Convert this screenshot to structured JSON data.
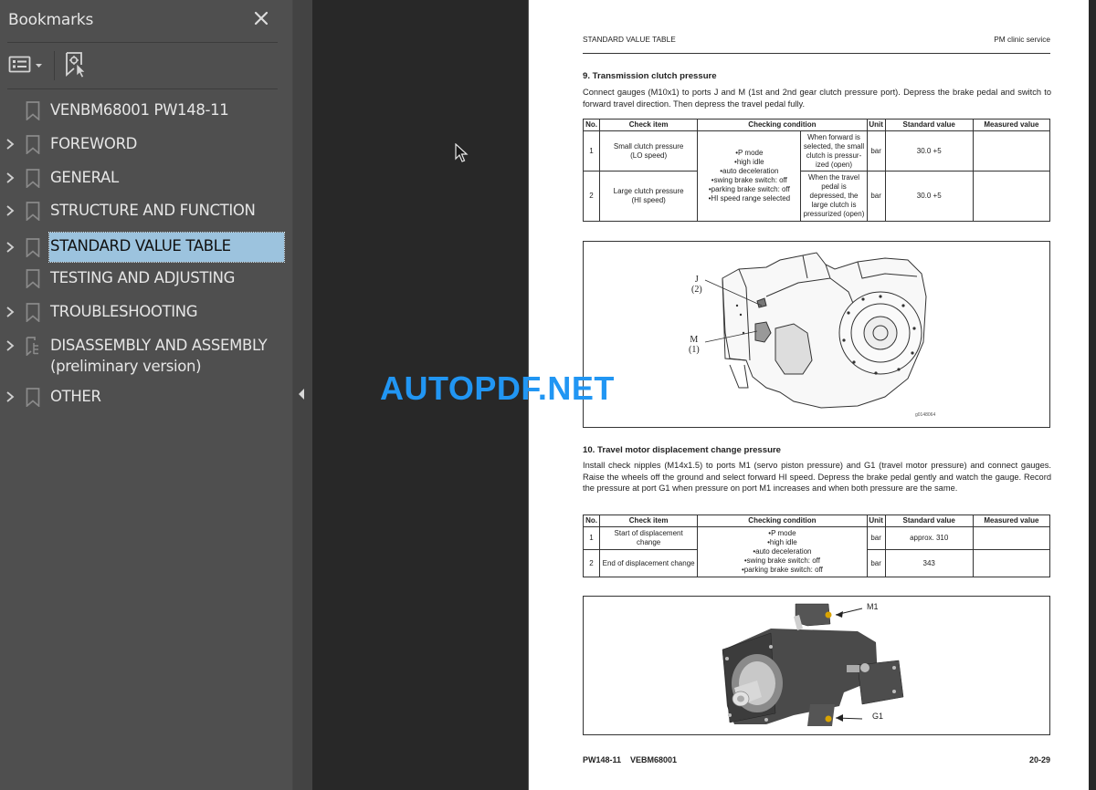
{
  "sidebar": {
    "title": "Bookmarks",
    "close_icon": "close-icon",
    "toolbar": {
      "options_icon": "list-options-icon",
      "options_dropdown_icon": "caret-down-icon",
      "find_bookmark_icon": "find-current-bookmark-icon"
    },
    "items": [
      {
        "label": "VENBM68001 PW148-11",
        "expandable": false,
        "icon": "bookmark-icon",
        "selected": false
      },
      {
        "label": "FOREWORD",
        "expandable": true,
        "icon": "bookmark-icon",
        "selected": false
      },
      {
        "label": "GENERAL",
        "expandable": true,
        "icon": "bookmark-icon",
        "selected": false
      },
      {
        "label": "STRUCTURE AND FUNCTION",
        "expandable": true,
        "icon": "bookmark-icon",
        "selected": false
      },
      {
        "label": "STANDARD VALUE TABLE",
        "expandable": true,
        "icon": "bookmark-icon",
        "selected": true
      },
      {
        "label": "TESTING AND ADJUSTING",
        "expandable": false,
        "icon": "bookmark-icon",
        "selected": false
      },
      {
        "label": "TROUBLESHOOTING",
        "expandable": true,
        "icon": "bookmark-icon",
        "selected": false
      },
      {
        "label": "DISASSEMBLY AND ASSEMBLY",
        "label_line2": "(preliminary version)",
        "expandable": true,
        "icon": "tagged-bookmark-icon",
        "selected": false
      },
      {
        "label": "OTHER",
        "expandable": true,
        "icon": "bookmark-icon",
        "selected": false
      }
    ],
    "collapse_icon": "collapse-panel-icon"
  },
  "colors": {
    "sidebar_bg": "#4f4f4f",
    "doc_bg": "#282828",
    "selected_bg": "#9cc3de",
    "watermark": "#2196f3"
  },
  "page": {
    "header_left": "STANDARD VALUE TABLE",
    "header_right": "PM clinic service",
    "section9": {
      "title": "9.   Transmission clutch pressure",
      "body": "Connect gauges (M10x1) to ports J and M (1st and 2nd gear clutch pressure port). Depress the brake pedal and switch to forward travel direction. Then depress the travel pedal fully.",
      "table": {
        "headers": [
          "No.",
          "Check item",
          "Checking condition",
          "Unit",
          "Standard value",
          "Measured value"
        ],
        "shared_condition": [
          "•P mode",
          "•high idle",
          "•auto deceleration",
          "•swing brake switch: off",
          "•parking brake switch: off",
          "•HI speed range selected"
        ],
        "rows": [
          {
            "no": "1",
            "item": [
              "Small clutch pressure",
              "(LO speed)"
            ],
            "condition": [
              "When forward is",
              "selected, the small",
              "clutch is pressur-",
              "ized (open)"
            ],
            "unit": "bar",
            "standard": "30.0 +5",
            "measured": ""
          },
          {
            "no": "2",
            "item": [
              "Large clutch pressure",
              "(HI speed)"
            ],
            "condition": [
              "When the travel",
              "pedal is",
              "depressed, the",
              "large clutch is",
              "pressurized (open)"
            ],
            "unit": "bar",
            "standard": "30.0 +5",
            "measured": ""
          }
        ]
      },
      "figure": {
        "labels": [
          {
            "letter": "J",
            "num": "(2)"
          },
          {
            "letter": "M",
            "num": "(1)"
          }
        ],
        "id": "g0148064"
      }
    },
    "section10": {
      "title": "10. Travel motor displacement change pressure",
      "body": "Install check nipples (M14x1.5) to ports M1 (servo piston pressure) and G1 (travel motor pressure) and connect gauges. Raise the wheels off the ground and select forward HI speed. Depress the brake pedal gently and watch the gauge. Record the pressure at port G1 when pressure on port M1 increases and when both pressure are the same.",
      "table": {
        "headers": [
          "No.",
          "Check item",
          "Checking condition",
          "Unit",
          "Standard value",
          "Measured value"
        ],
        "shared_condition": [
          "•P mode",
          "•high idle",
          "•auto deceleration",
          "•swing brake switch: off",
          "•parking brake switch: off"
        ],
        "rows": [
          {
            "no": "1",
            "item": [
              "Start of displacement",
              "change"
            ],
            "unit": "bar",
            "standard": "approx. 310",
            "measured": ""
          },
          {
            "no": "2",
            "item": [
              "End of displacement change"
            ],
            "unit": "bar",
            "standard": "343",
            "measured": ""
          }
        ]
      },
      "figure": {
        "labels": [
          "M1",
          "G1"
        ]
      }
    },
    "footer_left": "PW148-11    VEBM68001",
    "footer_right": "20-29"
  },
  "watermark": "AUTOPDF.NET"
}
